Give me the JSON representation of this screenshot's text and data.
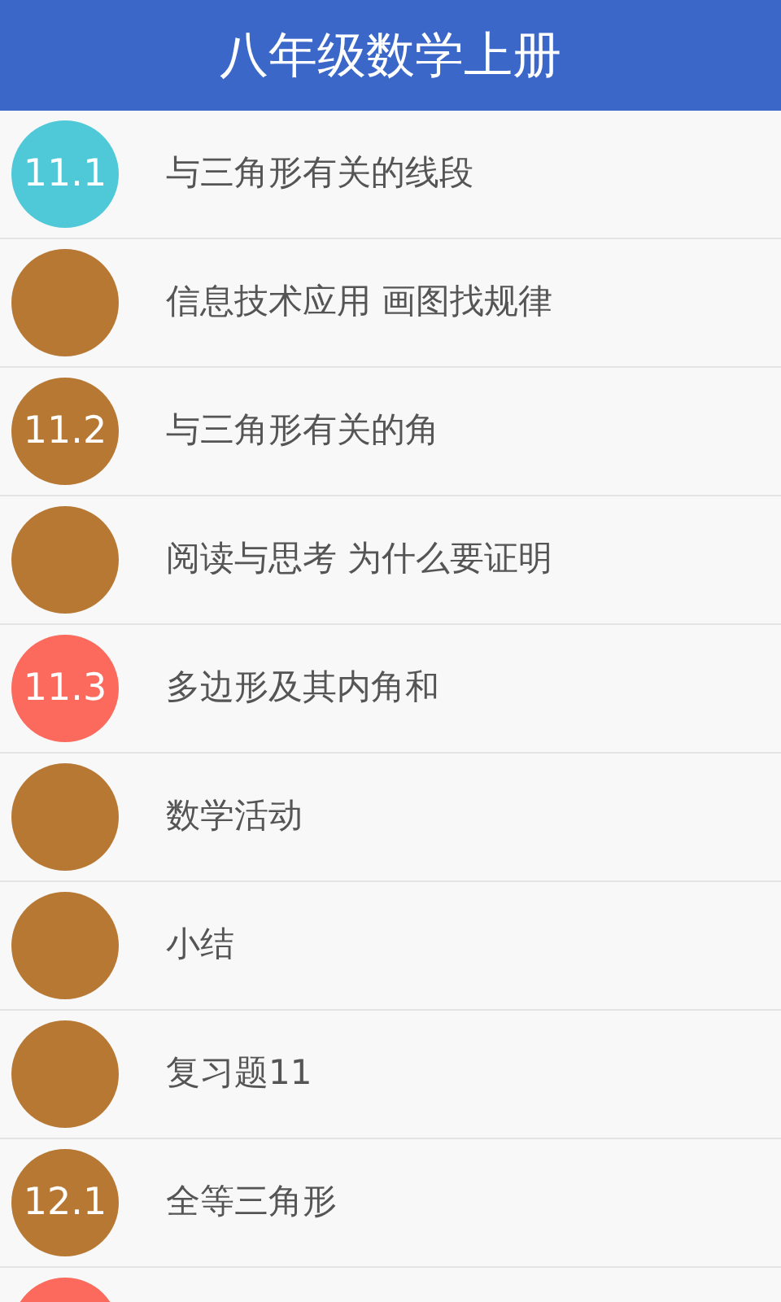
{
  "header": {
    "title": "八年级数学上册"
  },
  "items": [
    {
      "number": "11.1",
      "title": "与三角形有关的线段",
      "color": "#4fc8d8"
    },
    {
      "title": "信息技术应用 画图找规律",
      "color": "#b77834"
    },
    {
      "number": "11.2",
      "title": "与三角形有关的角",
      "color": "#b77834"
    },
    {
      "title": "阅读与思考 为什么要证明",
      "color": "#b77834"
    },
    {
      "number": "11.3",
      "title": "多边形及其内角和",
      "color": "#fb6a5c"
    },
    {
      "title": "数学活动",
      "color": "#b77834"
    },
    {
      "title": "小结",
      "color": "#b77834"
    },
    {
      "title": "复习题11",
      "color": "#b77834"
    },
    {
      "number": "12.1",
      "title": "全等三角形",
      "color": "#b77834"
    },
    {
      "color": "#fb6a5c"
    }
  ]
}
